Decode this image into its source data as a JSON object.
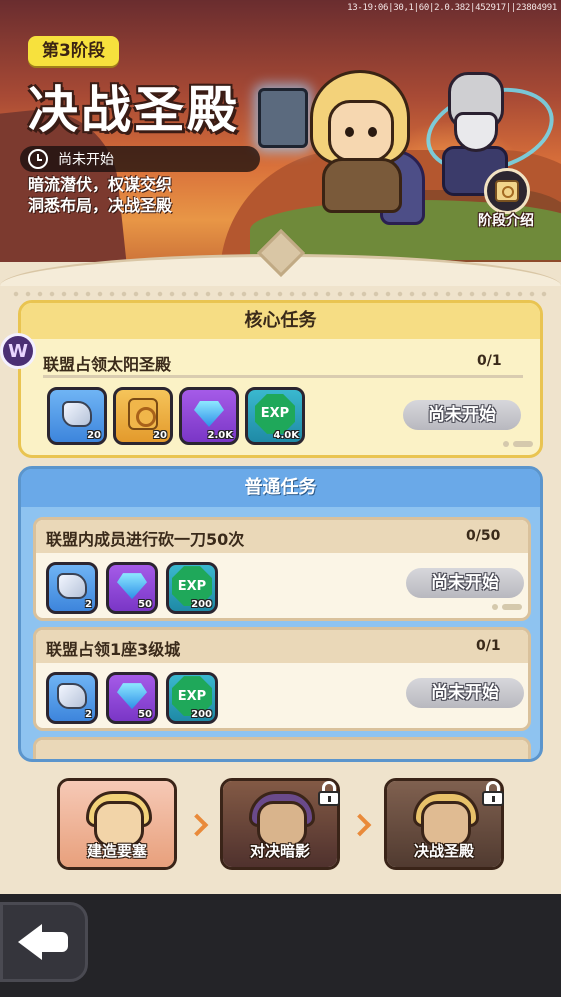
{
  "debug_text": "13-19:06|30,1|60|2.0.382|452917||23804991",
  "header": {
    "stage_tag": "第3阶段",
    "title": "决战圣殿",
    "status": "尚未开始",
    "description_line1": "暗流潜伏，权谋交织",
    "description_line2": "洞悉布局，决战圣殿",
    "intro_label": "阶段介绍"
  },
  "core": {
    "header": "核心任务",
    "badge": "W",
    "task": {
      "name": "联盟占领太阳圣殿",
      "progress": "0/1",
      "button": "尚未开始",
      "rewards": [
        {
          "icon": "ore-icon",
          "qty": "20"
        },
        {
          "icon": "scroll-icon",
          "qty": "20"
        },
        {
          "icon": "diamond-icon",
          "qty": "2.0K"
        },
        {
          "icon": "exp-icon",
          "label": "EXP",
          "qty": "4.0K"
        }
      ]
    }
  },
  "normal": {
    "header": "普通任务",
    "tasks": [
      {
        "name": "联盟内成员进行砍一刀50次",
        "progress": "0/50",
        "button": "尚未开始",
        "rewards": [
          {
            "icon": "ore-icon",
            "qty": "2"
          },
          {
            "icon": "diamond-icon",
            "qty": "50"
          },
          {
            "icon": "exp-icon",
            "label": "EXP",
            "qty": "200"
          }
        ]
      },
      {
        "name": "联盟占领1座3级城",
        "progress": "0/1",
        "button": "尚未开始",
        "rewards": [
          {
            "icon": "ore-icon",
            "qty": "2"
          },
          {
            "icon": "diamond-icon",
            "qty": "50"
          },
          {
            "icon": "exp-icon",
            "label": "EXP",
            "qty": "200"
          }
        ]
      }
    ]
  },
  "stages": [
    {
      "label": "建造要塞",
      "locked": false
    },
    {
      "label": "对决暗影",
      "locked": true
    },
    {
      "label": "决战圣殿",
      "locked": true
    }
  ]
}
